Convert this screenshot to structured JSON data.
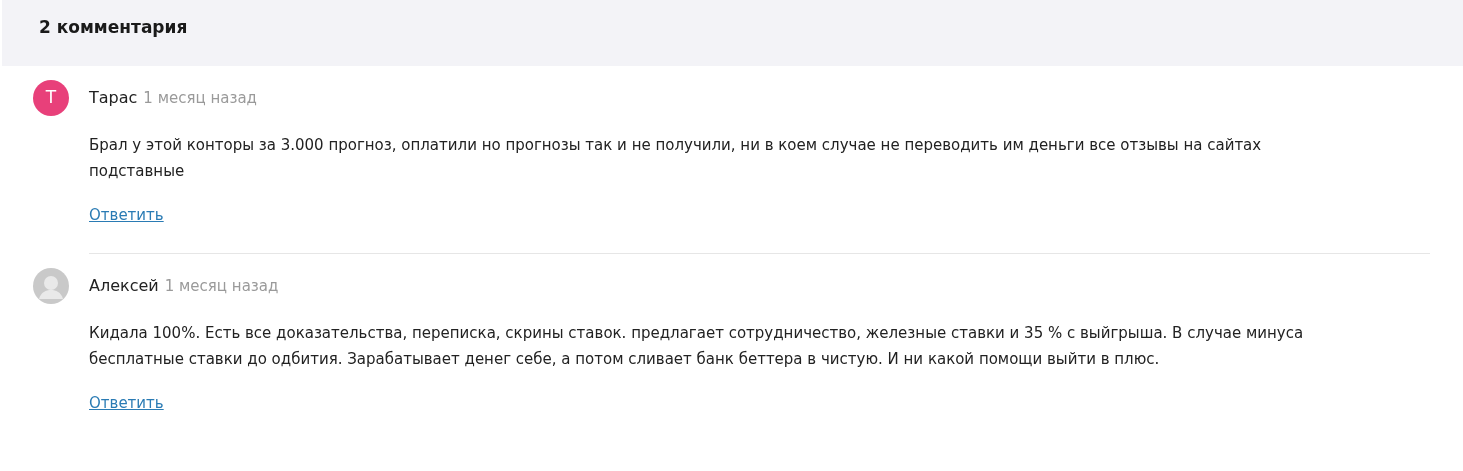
{
  "header": {
    "title": "2 комментария"
  },
  "comments": [
    {
      "author": "Тарас",
      "time": "1 месяц назад",
      "avatar": {
        "kind": "letter",
        "letter": "Т",
        "color": "#e8407a"
      },
      "text": "Брал у этой конторы за 3.000 прогноз, оплатили но прогнозы так и не получили, ни в коем случае не переводить им деньги все отзывы на сайтах подставные",
      "reply": "Ответить"
    },
    {
      "author": "Алексей",
      "time": "1 месяц назад",
      "avatar": {
        "kind": "silhouette"
      },
      "text": "Кидала 100%. Есть все доказательства, переписка, скрины ставок. предлагает сотрудничество, железные ставки и 35 % с выйгрыша. В случае минуса бесплатные ставки до одбития. Зарабатывает денег себе, а потом сливает банк беттера в чистую. И ни какой помощи выйти в плюс.",
      "reply": "Ответить"
    }
  ]
}
